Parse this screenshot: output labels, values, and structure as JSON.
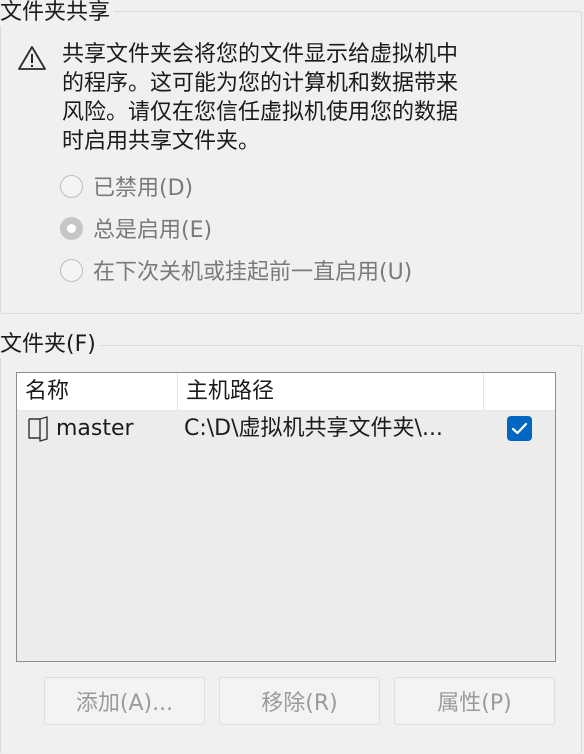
{
  "sharing": {
    "legend": "文件夹共享",
    "warning_lines": [
      "共享文件夹会将您的文件显示给虚拟机中",
      "的程序。这可能为您的计算机和数据带来",
      "风险。请仅在您信任虚拟机使用您的数据",
      "时启用共享文件夹。"
    ],
    "options": [
      {
        "label": "已禁用(D)",
        "checked": false
      },
      {
        "label": "总是启用(E)",
        "checked": true
      },
      {
        "label": "在下次关机或挂起前一直启用(U)",
        "checked": false
      }
    ]
  },
  "folders": {
    "legend": "文件夹(F)",
    "columns": {
      "name": "名称",
      "host_path": "主机路径"
    },
    "rows": [
      {
        "name": "master",
        "host_path": "C:\\D\\虚拟机共享文件夹\\...",
        "enabled": true
      }
    ],
    "buttons": {
      "add": "添加(A)...",
      "remove": "移除(R)",
      "properties": "属性(P)"
    }
  },
  "colors": {
    "accent": "#0067c0",
    "background": "#f0f0f0",
    "disabled_text": "#7a7a7a"
  },
  "icons": {
    "warning": "warning-icon",
    "folder": "folder-icon",
    "check": "checkmark-icon"
  }
}
